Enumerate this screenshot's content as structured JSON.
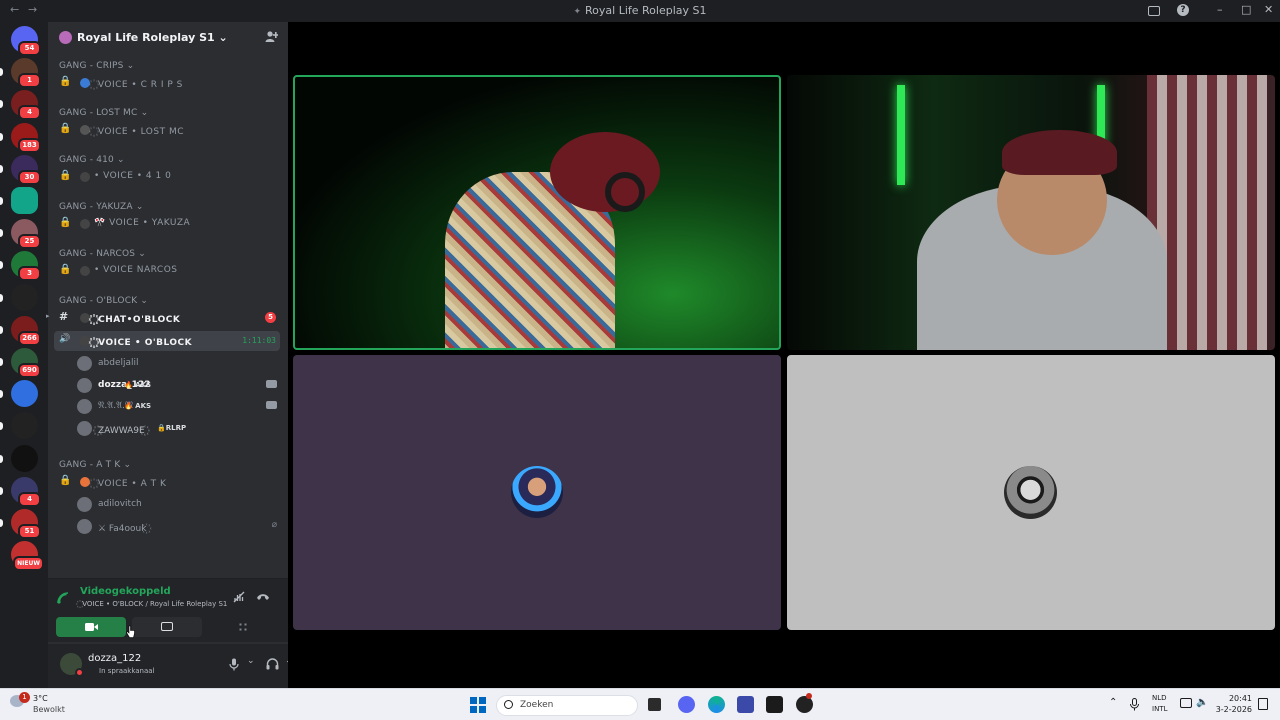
{
  "window": {
    "title": "Royal Life Roleplay S1",
    "back_glyph": "←",
    "forward_glyph": "→",
    "inbox_icon": "inbox-icon",
    "help_glyph": "?",
    "minimize_glyph": "–",
    "maximize_glyph": "□",
    "close_glyph": "✕"
  },
  "guilds": [
    {
      "badge": "54",
      "color": "#5865f2"
    },
    {
      "badge": "1",
      "color": "#5a3a2a"
    },
    {
      "badge": "4",
      "color": "#7a1f1f"
    },
    {
      "badge": "183",
      "color": "#9b1b1b"
    },
    {
      "badge": "30",
      "color": "#3b2a5c"
    },
    {
      "badge": "",
      "color": "#12a58a"
    },
    {
      "badge": "25",
      "color": "#8a5a60"
    },
    {
      "badge": "3",
      "color": "#1f7a3a"
    },
    {
      "badge": "",
      "color": "#222"
    },
    {
      "badge": "266",
      "color": "#7b1d1d"
    },
    {
      "badge": "690",
      "color": "#2d5a3a"
    },
    {
      "badge": "",
      "color": "#2f6fe0"
    },
    {
      "badge": "",
      "color": "#222"
    },
    {
      "badge": "",
      "color": "#111"
    },
    {
      "badge": "4",
      "color": "#3a3a6a"
    },
    {
      "badge": "51",
      "color": "#b12a2a"
    },
    {
      "badge": "NIEUW",
      "color": "#c23030"
    }
  ],
  "server": {
    "name": "Royal Life Roleplay S1",
    "name_chevron": "⌄",
    "invite_icon": "add-member-icon"
  },
  "categories": [
    {
      "label": "GANG - CRIPS ⌄",
      "channels": [
        {
          "label": "꙰ VOICE • C R I P S",
          "dot": "#3a7bd5"
        }
      ]
    },
    {
      "label": "GANG - LOST MC ⌄",
      "channels": [
        {
          "label": "꙰ VOICE • LOST MC",
          "dot": "#555"
        }
      ]
    },
    {
      "label": "GANG - 410 ⌄",
      "channels": [
        {
          "label": "• VOICE • 4 1 0",
          "dot": "#444"
        }
      ]
    },
    {
      "label": "GANG - YAKUZA ⌄",
      "channels": [
        {
          "label": "🎌 VOICE • YAKUZA",
          "dot": "#444"
        }
      ]
    },
    {
      "label": "GANG - NARCOS ⌄",
      "channels": [
        {
          "label": "• VOICE NARCOS",
          "dot": "#444"
        }
      ]
    },
    {
      "label": "GANG - O'BLOCK ⌄",
      "channels": [
        {
          "label": "꙰ CHAT•O'BLOCK",
          "dot": "#444",
          "badge": "5"
        },
        {
          "label": "꙰ VOICE • O'BLOCK",
          "dot": "#444",
          "timer": "1:11:03"
        }
      ]
    },
    {
      "label": "GANG - A T K ⌄",
      "channels": [
        {
          "label": "꙰ VOICE • A T K",
          "dot": "#e8743b"
        }
      ]
    }
  ],
  "oblock_members": [
    {
      "name": "abdeljalil",
      "tag": "",
      "cam": false
    },
    {
      "name": "dozza_122",
      "tag": "🔥 AKS",
      "cam": true
    },
    {
      "name": "𝔑.𝔄.𝔄.𝔐",
      "tag": "🔥 AKS",
      "cam": true
    },
    {
      "name": "꙰ZAWWA9E꙰",
      "tag": "🔒RLRP",
      "cam": false
    }
  ],
  "atk_members": [
    {
      "name": "adilovitch"
    },
    {
      "name": "⚔ Fa4oouk꙰"
    }
  ],
  "voice_status": {
    "title": "Videogekoppeld",
    "subtitle": "꙰ VOICE • O'BLOCK / Royal Life Roleplay S1"
  },
  "user": {
    "name": "dozza_122",
    "status": "In spraakkanaal"
  },
  "taskbar": {
    "weather_temp": "3°C",
    "weather_text": "Bewolkt",
    "notification_badge": "1",
    "search_placeholder": "Zoeken",
    "lang_top": "NLD",
    "lang_bottom": "INTL",
    "time": "20:41",
    "date": "3-2-2026"
  }
}
